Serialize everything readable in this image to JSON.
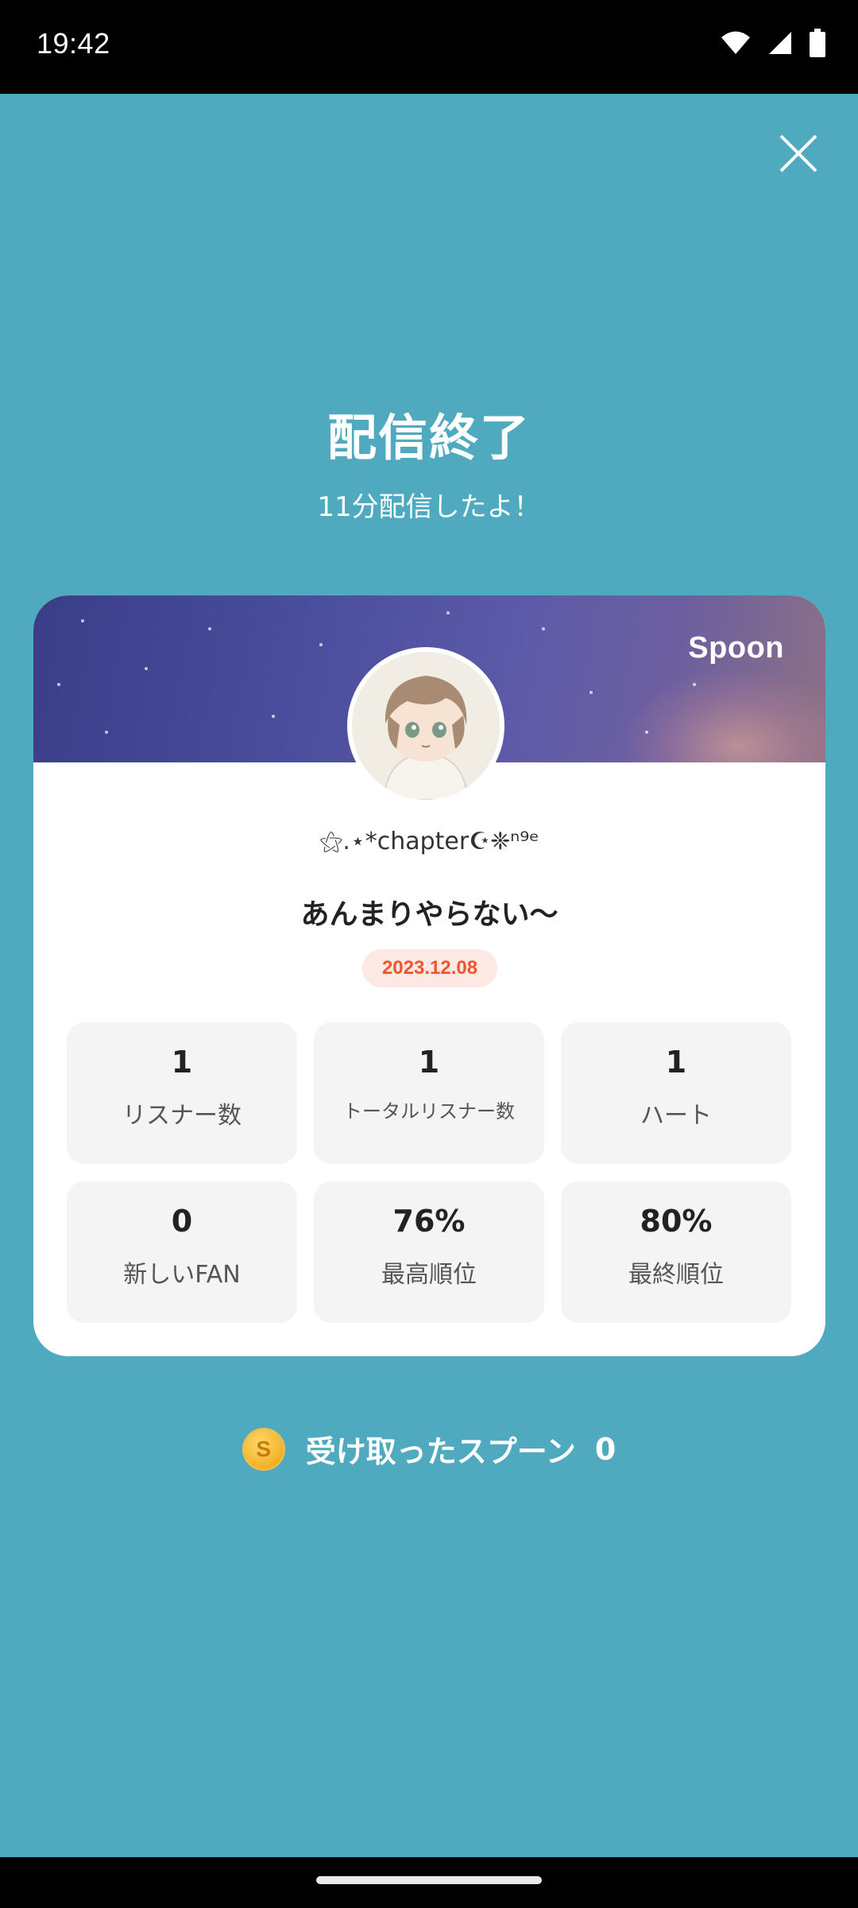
{
  "status_bar": {
    "time": "19:42",
    "icons": [
      "wifi-icon",
      "signal-icon",
      "battery-icon"
    ]
  },
  "close_icon": "close-icon",
  "header": {
    "title": "配信終了",
    "subtitle": "11分配信したよ！"
  },
  "card": {
    "brand": "Spoon",
    "username": "⚝.⋆*chapter☪︎❈ⁿ⁹ᵉ",
    "live_title": "あんまりやらない〜",
    "date": "2023.12.08",
    "stats": [
      {
        "value": "1",
        "label": "リスナー数"
      },
      {
        "value": "1",
        "label": "トータルリスナー数"
      },
      {
        "value": "1",
        "label": "ハート"
      },
      {
        "value": "0",
        "label": "新しいFAN"
      },
      {
        "value": "76%",
        "label": "最高順位"
      },
      {
        "value": "80%",
        "label": "最終順位"
      }
    ]
  },
  "spoons": {
    "coin_symbol": "S",
    "label": "受け取ったスプーン",
    "count": "0"
  },
  "colors": {
    "background": "#4fa9bf",
    "date_badge_text": "#ef5630",
    "date_badge_bg": "#fde8e3"
  }
}
